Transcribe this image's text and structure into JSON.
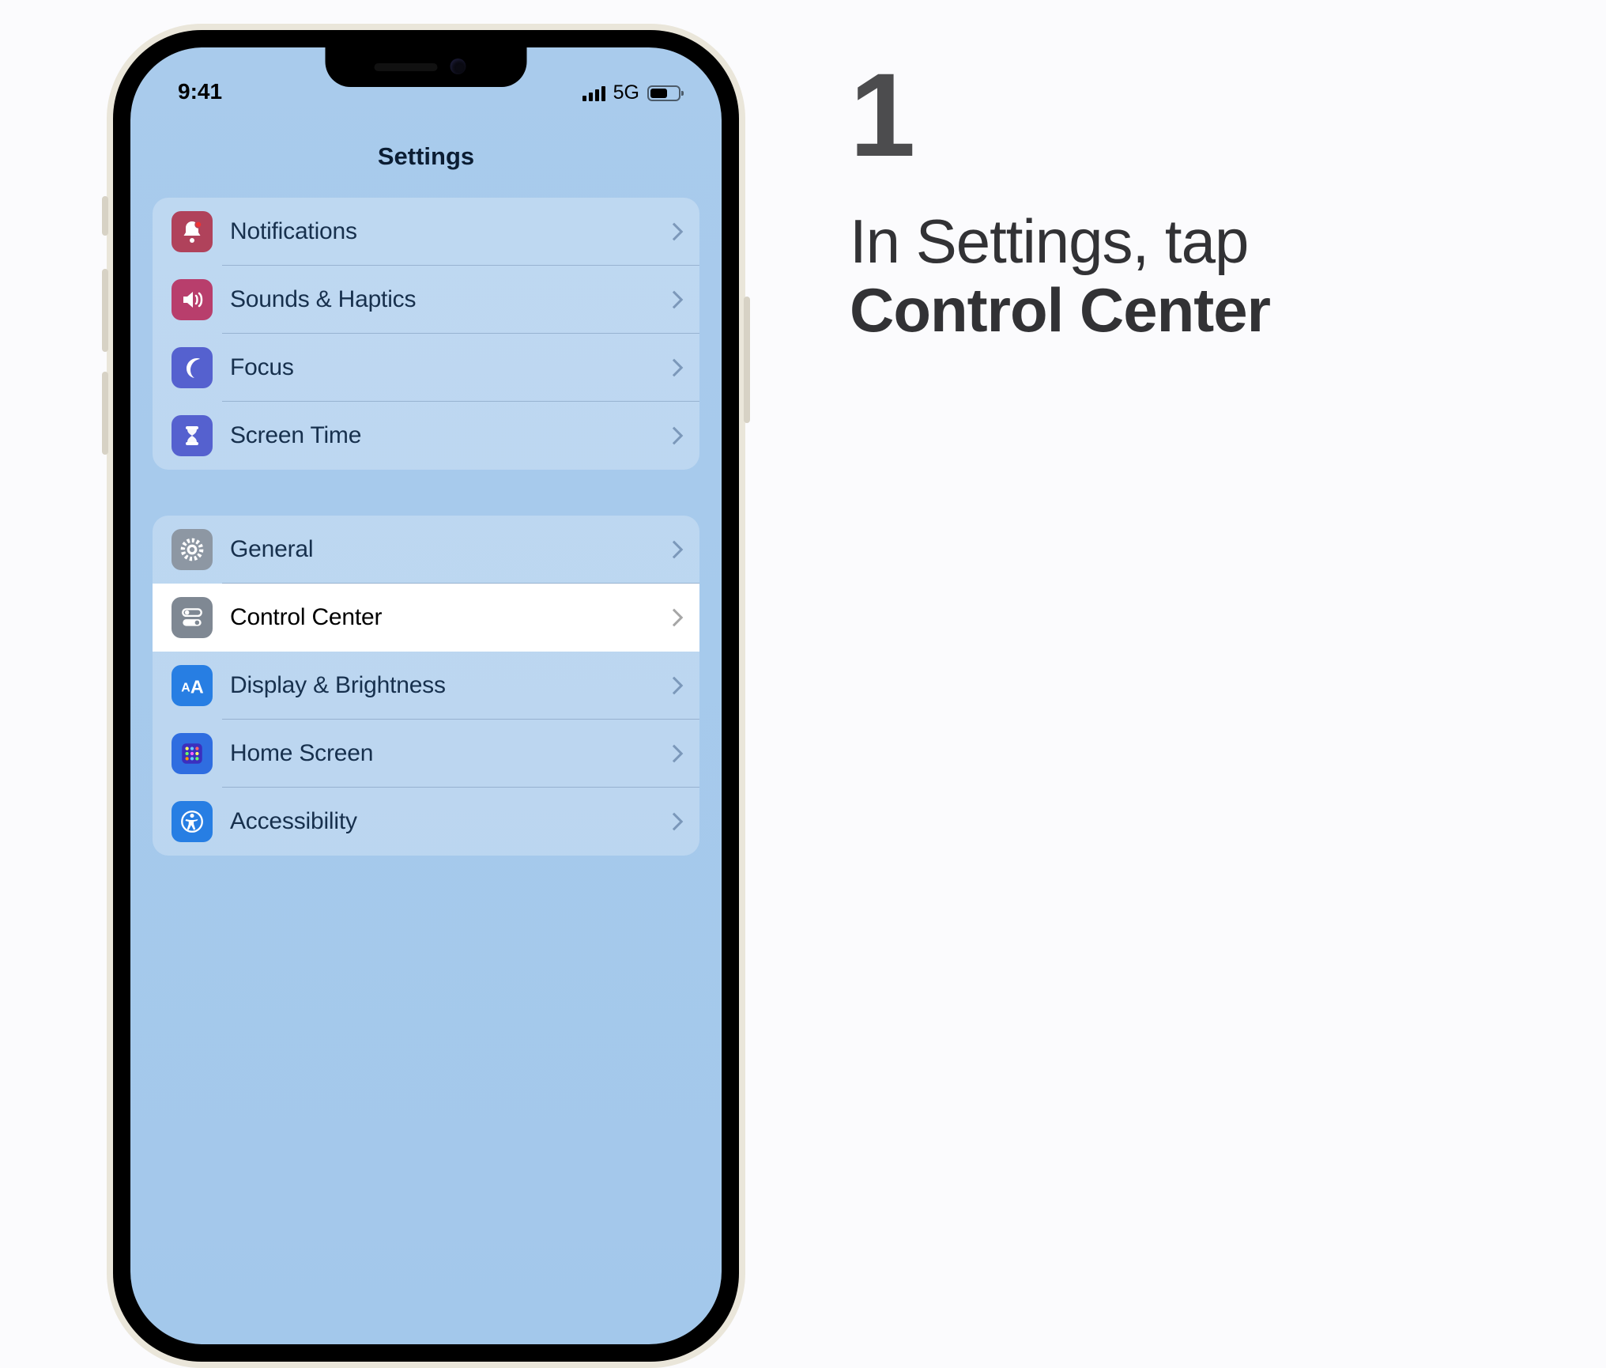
{
  "status": {
    "time": "9:41",
    "network": "5G"
  },
  "nav": {
    "title": "Settings"
  },
  "groups": [
    {
      "rows": [
        {
          "label": "Notifications",
          "icon": "bell-badge-icon",
          "color": "bg-red"
        },
        {
          "label": "Sounds & Haptics",
          "icon": "speaker-icon",
          "color": "bg-pink"
        },
        {
          "label": "Focus",
          "icon": "moon-icon",
          "color": "bg-indigo"
        },
        {
          "label": "Screen Time",
          "icon": "hourglass-icon",
          "color": "bg-indigo2"
        }
      ]
    },
    {
      "rows": [
        {
          "label": "General",
          "icon": "gear-icon",
          "color": "bg-gray"
        },
        {
          "label": "Control Center",
          "icon": "switches-icon",
          "color": "bg-gray2",
          "highlight": true
        },
        {
          "label": "Display & Brightness",
          "icon": "text-size-icon",
          "color": "bg-blue"
        },
        {
          "label": "Home Screen",
          "icon": "app-grid-icon",
          "color": "bg-blue2"
        },
        {
          "label": "Accessibility",
          "icon": "accessibility-icon",
          "color": "bg-blue3"
        }
      ]
    }
  ],
  "instruction": {
    "step": "1",
    "line1": "In Settings, tap",
    "line2_bold": "Control Center"
  }
}
